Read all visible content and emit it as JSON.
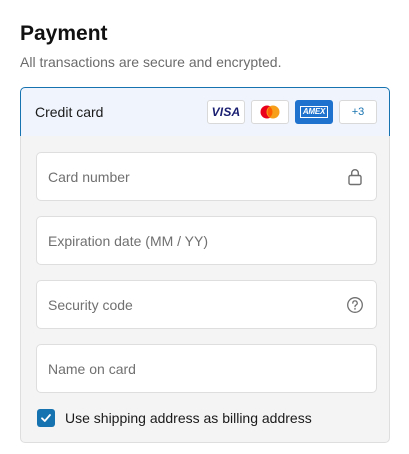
{
  "header": {
    "title": "Payment",
    "subtitle": "All transactions are secure and encrypted."
  },
  "payment_method": {
    "label": "Credit card",
    "brands": [
      {
        "name": "visa",
        "text": "VISA"
      },
      {
        "name": "mastercard",
        "text": ""
      },
      {
        "name": "amex",
        "text": "AMEX"
      },
      {
        "name": "more",
        "text": "+3"
      }
    ]
  },
  "fields": {
    "card_number": {
      "placeholder": "Card number",
      "icon": "lock-icon"
    },
    "expiration": {
      "placeholder": "Expiration date (MM / YY)"
    },
    "security_code": {
      "placeholder": "Security code",
      "icon": "question-circle-icon"
    },
    "name_on_card": {
      "placeholder": "Name on card"
    }
  },
  "billing": {
    "checked": true,
    "label": "Use shipping address as billing address"
  },
  "colors": {
    "accent": "#1773b0",
    "selected_bg": "#f0f5fd",
    "body_bg": "#f4f4f4"
  }
}
